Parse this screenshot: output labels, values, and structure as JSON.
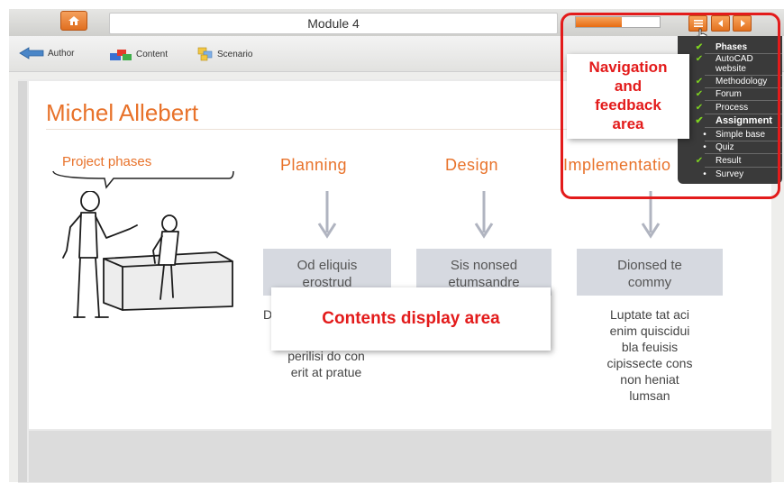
{
  "header": {
    "module_title": "Module 4",
    "progress_percent": 55,
    "icons": [
      "home-icon",
      "menu-icon",
      "prev-arrow-icon",
      "next-arrow-icon"
    ]
  },
  "toolbar": {
    "items": [
      {
        "label": "Author",
        "icon": "back-arrow-icon"
      },
      {
        "label": "Content",
        "icon": "blocks-icon"
      },
      {
        "label": "Scenario",
        "icon": "windows-icon"
      }
    ]
  },
  "slide": {
    "name": "Michel Allebert",
    "speech_bubble": "Project phases",
    "phases": [
      {
        "title": "Planning",
        "box": [
          "Od eliquis",
          "erostrud"
        ],
        "text": [
          "D",
          "",
          "perilisi do con",
          "erit at pratue"
        ]
      },
      {
        "title": "Design",
        "box": [
          "Sis nonsed",
          "etumsandre"
        ],
        "text": []
      },
      {
        "title": "Implementatio",
        "box": [
          "Dionsed te",
          "commy"
        ],
        "text": [
          "Luptate tat aci",
          "enim quiscidui",
          "bla feuisis",
          "cipissecte cons",
          "non heniat",
          "lumsan"
        ]
      }
    ]
  },
  "callouts": {
    "navigation": [
      "Navigation",
      "and",
      "feedback",
      "area"
    ],
    "contents": "Contents display area"
  },
  "menu": {
    "items": [
      {
        "label": "Phases",
        "status": "check",
        "bold": true
      },
      {
        "label": "AutoCAD",
        "label2": "website",
        "status": "check",
        "bold": false
      },
      {
        "label": "Methodology",
        "status": "check",
        "bold": false
      },
      {
        "label": "Forum",
        "status": "check",
        "bold": false
      },
      {
        "label": "Process",
        "status": "check",
        "bold": false
      },
      {
        "label": "Assignment",
        "status": "check",
        "bold": true
      },
      {
        "label": "Simple base",
        "status": "dot",
        "bold": false
      },
      {
        "label": "Quiz",
        "status": "dot",
        "bold": false
      },
      {
        "label": "Result",
        "status": "check",
        "bold": false
      },
      {
        "label": "Survey",
        "status": "dot",
        "bold": false
      }
    ]
  },
  "colors": {
    "accent": "#e8722a",
    "highlight_red": "#e31b1b",
    "check_green": "#7ed321"
  }
}
